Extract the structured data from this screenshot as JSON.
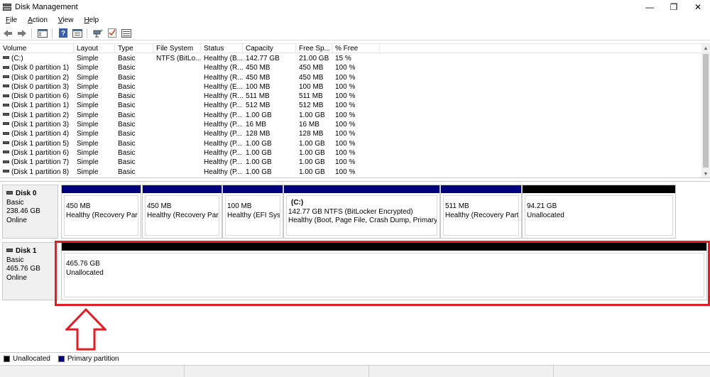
{
  "window": {
    "title": "Disk Management",
    "controls": {
      "minimize": "—",
      "maximize": "❐",
      "close": "✕"
    }
  },
  "menu": {
    "items": [
      {
        "label": "File",
        "accel": "F"
      },
      {
        "label": "Action",
        "accel": "A"
      },
      {
        "label": "View",
        "accel": "V"
      },
      {
        "label": "Help",
        "accel": "H"
      }
    ]
  },
  "toolbar": {
    "buttons": [
      "back-arrow-icon",
      "forward-arrow-icon",
      "console-tree-icon",
      "help-icon",
      "properties-icon",
      "connect-icon",
      "checklist-icon",
      "list-view-icon"
    ]
  },
  "volume_list": {
    "columns": [
      "Volume",
      "Layout",
      "Type",
      "File System",
      "Status",
      "Capacity",
      "Free Sp...",
      "% Free"
    ],
    "rows": [
      [
        "(C:)",
        "Simple",
        "Basic",
        "NTFS (BitLo...",
        "Healthy (B...",
        "142.77 GB",
        "21.00 GB",
        "15 %"
      ],
      [
        "(Disk 0 partition 1)",
        "Simple",
        "Basic",
        "",
        "Healthy (R...",
        "450 MB",
        "450 MB",
        "100 %"
      ],
      [
        "(Disk 0 partition 2)",
        "Simple",
        "Basic",
        "",
        "Healthy (R...",
        "450 MB",
        "450 MB",
        "100 %"
      ],
      [
        "(Disk 0 partition 3)",
        "Simple",
        "Basic",
        "",
        "Healthy (E...",
        "100 MB",
        "100 MB",
        "100 %"
      ],
      [
        "(Disk 0 partition 6)",
        "Simple",
        "Basic",
        "",
        "Healthy (R...",
        "511 MB",
        "511 MB",
        "100 %"
      ],
      [
        "(Disk 1 partition 1)",
        "Simple",
        "Basic",
        "",
        "Healthy (P...",
        "512 MB",
        "512 MB",
        "100 %"
      ],
      [
        "(Disk 1 partition 2)",
        "Simple",
        "Basic",
        "",
        "Healthy (P...",
        "1.00 GB",
        "1.00 GB",
        "100 %"
      ],
      [
        "(Disk 1 partition 3)",
        "Simple",
        "Basic",
        "",
        "Healthy (P...",
        "16 MB",
        "16 MB",
        "100 %"
      ],
      [
        "(Disk 1 partition 4)",
        "Simple",
        "Basic",
        "",
        "Healthy (P...",
        "128 MB",
        "128 MB",
        "100 %"
      ],
      [
        "(Disk 1 partition 5)",
        "Simple",
        "Basic",
        "",
        "Healthy (P...",
        "1.00 GB",
        "1.00 GB",
        "100 %"
      ],
      [
        "(Disk 1 partition 6)",
        "Simple",
        "Basic",
        "",
        "Healthy (P...",
        "1.00 GB",
        "1.00 GB",
        "100 %"
      ],
      [
        "(Disk 1 partition 7)",
        "Simple",
        "Basic",
        "",
        "Healthy (P...",
        "1.00 GB",
        "1.00 GB",
        "100 %"
      ],
      [
        "(Disk 1 partition 8)",
        "Simple",
        "Basic",
        "",
        "Healthy (P...",
        "1.00 GB",
        "1.00 GB",
        "100 %"
      ]
    ]
  },
  "disks": [
    {
      "name": "Disk 0",
      "type": "Basic",
      "size": "238.46 GB",
      "state": "Online",
      "partitions": [
        {
          "volume": "",
          "line1": "450 MB",
          "line2": "Healthy (Recovery Partiti",
          "kind": "primary"
        },
        {
          "volume": "",
          "line1": "450 MB",
          "line2": "Healthy (Recovery Partiti",
          "kind": "primary"
        },
        {
          "volume": "",
          "line1": "100 MB",
          "line2": "Healthy (EFI Syste",
          "kind": "primary"
        },
        {
          "volume": "(C:)",
          "line1": "142.77 GB NTFS (BitLocker Encrypted)",
          "line2": "Healthy (Boot, Page File, Crash Dump, Primary Par",
          "kind": "primary"
        },
        {
          "volume": "",
          "line1": "511 MB",
          "line2": "Healthy (Recovery Partiti",
          "kind": "primary"
        },
        {
          "volume": "",
          "line1": "94.21 GB",
          "line2": "Unallocated",
          "kind": "unallocated"
        }
      ]
    },
    {
      "name": "Disk 1",
      "type": "Basic",
      "size": "465.76 GB",
      "state": "Online",
      "partitions": [
        {
          "volume": "",
          "line1": "465.76 GB",
          "line2": "Unallocated",
          "kind": "unallocated"
        }
      ]
    }
  ],
  "legend": [
    {
      "label": "Unallocated",
      "color": "#000000"
    },
    {
      "label": "Primary partition",
      "color": "#00007f"
    }
  ],
  "colors": {
    "primary_bar": "#00007f",
    "unallocated_bar": "#000000",
    "annotation": "#e31b23"
  }
}
